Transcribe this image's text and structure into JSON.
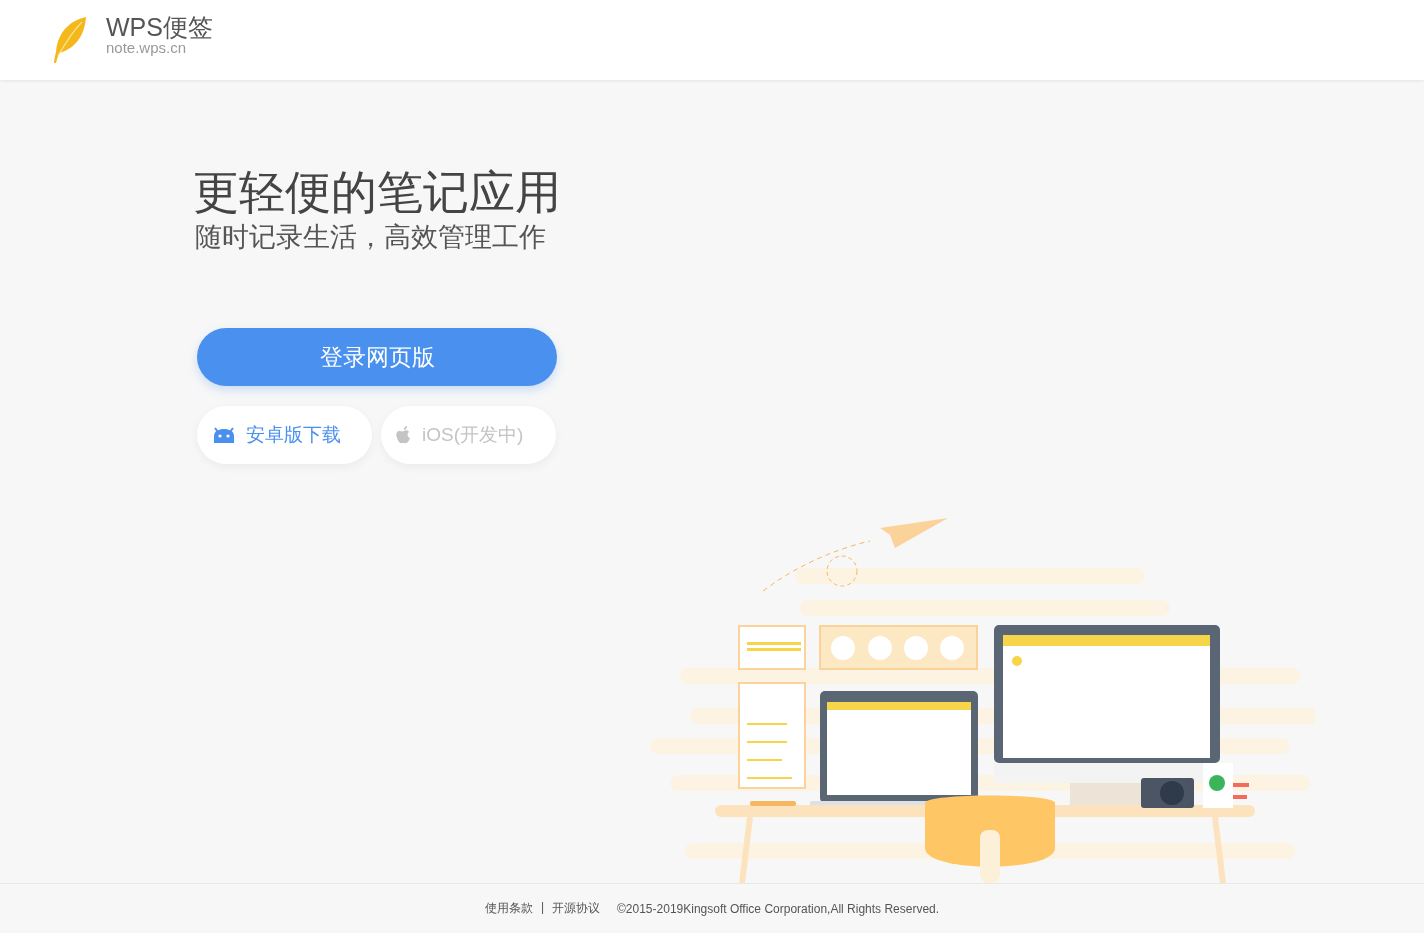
{
  "header": {
    "title": "WPS便签",
    "domain": "note.wps.cn"
  },
  "hero": {
    "headline": "更轻便的笔记应用",
    "subheadline": "随时记录生活，高效管理工作",
    "primary_button": {
      "label": "登录网页版"
    },
    "download_buttons": [
      {
        "kind": "android",
        "label": "安卓版下载",
        "disabled": false
      },
      {
        "kind": "apple",
        "label": "iOS(开发中)",
        "disabled": true
      }
    ]
  },
  "footer": {
    "links": [
      {
        "label": "使用条款"
      },
      {
        "label": "开源协议"
      }
    ],
    "separator": "|",
    "copyright": "©2015-2019Kingsoft Office Corporation,All Rights Reserved."
  }
}
